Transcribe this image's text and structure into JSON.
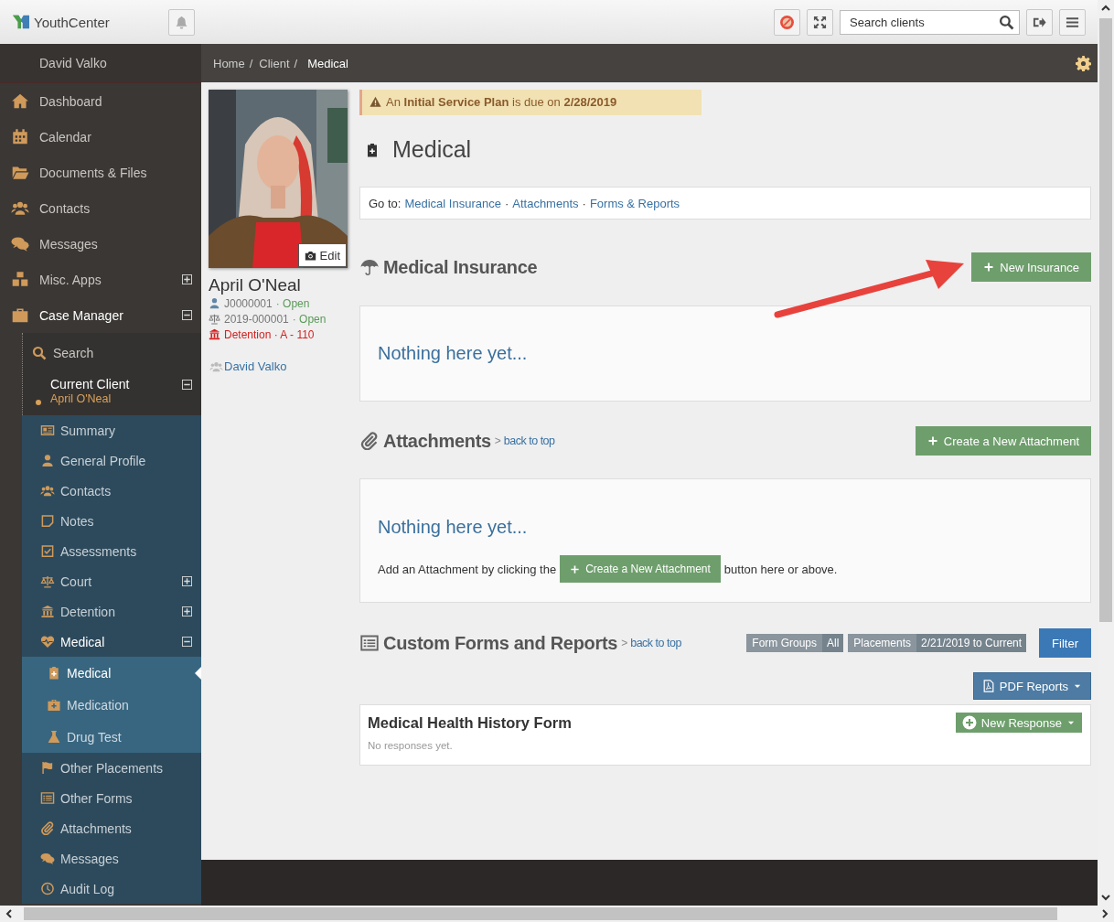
{
  "topbar": {
    "brand": "YouthCenter",
    "search": {
      "placeholder": "Search clients"
    }
  },
  "sidebar": {
    "user": "David Valko",
    "items": [
      {
        "label": "Dashboard",
        "selected": false
      },
      {
        "label": "Calendar",
        "selected": false
      },
      {
        "label": "Documents & Files",
        "selected": false
      },
      {
        "label": "Contacts",
        "selected": false
      },
      {
        "label": "Messages",
        "selected": false
      },
      {
        "label": "Misc. Apps",
        "selected": false,
        "expanded": false
      },
      {
        "label": "Case Manager",
        "selected": true,
        "expanded": true,
        "children": [
          {
            "label": "Search"
          },
          {
            "label": "Current Client",
            "subtitle": "April O'Neal",
            "expanded": true,
            "children": [
              {
                "label": "Summary",
                "selected": false
              },
              {
                "label": "General Profile",
                "selected": false
              },
              {
                "label": "Contacts",
                "selected": false
              },
              {
                "label": "Notes",
                "selected": false
              },
              {
                "label": "Assessments",
                "selected": false
              },
              {
                "label": "Court",
                "selected": false,
                "expanded": false
              },
              {
                "label": "Detention",
                "selected": false,
                "expanded": false
              },
              {
                "label": "Medical",
                "selected": true,
                "expanded": true,
                "children": [
                  {
                    "label": "Medical",
                    "selected": true
                  },
                  {
                    "label": "Medication",
                    "selected": false
                  },
                  {
                    "label": "Drug Test",
                    "selected": false
                  }
                ]
              },
              {
                "label": "Other Placements",
                "selected": false
              },
              {
                "label": "Other Forms",
                "selected": false
              },
              {
                "label": "Attachments",
                "selected": false
              },
              {
                "label": "Messages",
                "selected": false
              },
              {
                "label": "Audit Log",
                "selected": false
              }
            ]
          }
        ]
      }
    ]
  },
  "breadcrumb": {
    "items": [
      "Home",
      "Client",
      "Medical"
    ],
    "separator": "/"
  },
  "client": {
    "name": "April O'Neal",
    "photo_button": "Edit",
    "records": [
      {
        "kind": "youth",
        "number": "J0000001",
        "status": "· Open"
      },
      {
        "kind": "case",
        "number": "2019-000001",
        "status": "· Open"
      },
      {
        "kind": "placement",
        "number": "Detention · A - 110"
      }
    ],
    "worker": "David Valko"
  },
  "alert": "An **Initial Service Plan** is due on **2/28/2019**",
  "page_title": "Medical",
  "goto": {
    "label": "Go to:",
    "links": [
      "Medical Insurance",
      "Attachments",
      "Forms & Reports"
    ],
    "separator": "·"
  },
  "insurance": {
    "title": "Medical Insurance",
    "action": "New Insurance",
    "empty": "Nothing here yet..."
  },
  "attachments": {
    "title": "Attachments",
    "separator": ">",
    "back_link": "back to top",
    "action": "Create a New Attachment",
    "empty": "Nothing here yet...",
    "hint_before": "Add an Attachment by clicking the",
    "hint_button": "Create a New Attachment",
    "hint_after": "button here or above."
  },
  "custom_forms": {
    "title": "Custom Forms and Reports",
    "separator": ">",
    "back_link": "back to top",
    "filters": [
      {
        "label": "Form Groups",
        "value": "All"
      },
      {
        "label": "Placements",
        "value": "2/21/2019 to Current"
      }
    ],
    "filter_button": "Filter",
    "pdf_button": "PDF Reports",
    "forms": [
      {
        "title": "Medical Health History Form",
        "action": "New Response",
        "note": "No responses yet."
      }
    ]
  }
}
